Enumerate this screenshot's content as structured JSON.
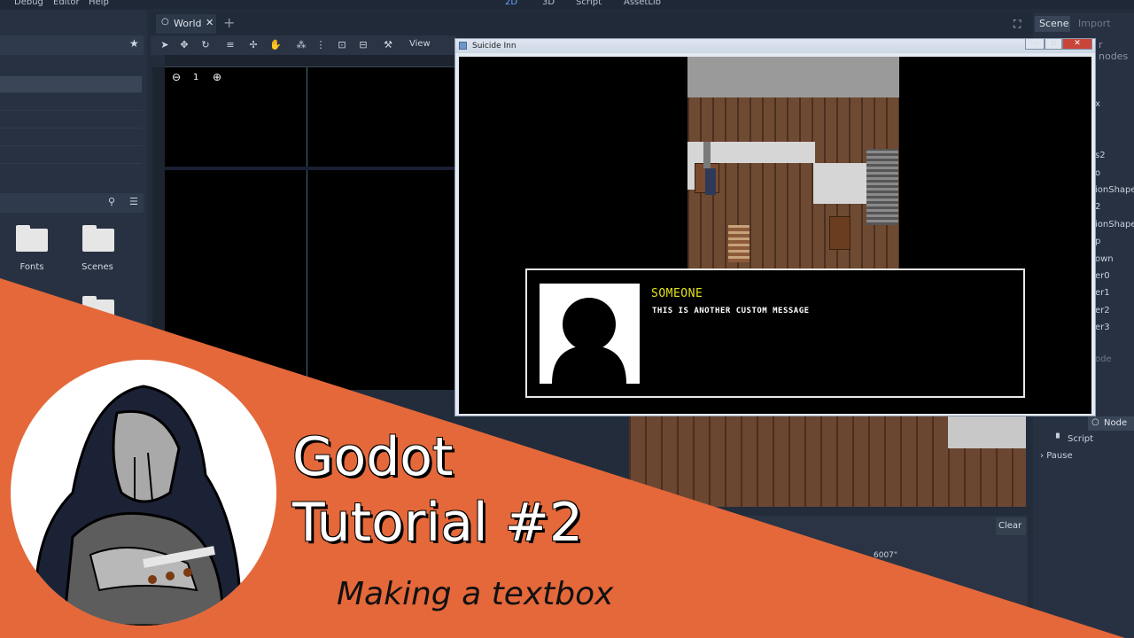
{
  "menu": {
    "debug": "Debug",
    "editor": "Editor",
    "help": "Help"
  },
  "main_modes": {
    "m2d": "2D",
    "m3d": "3D",
    "script": "Script",
    "assetlib": "AssetLib"
  },
  "filesystem": {
    "folders": [
      {
        "label": "Fonts"
      },
      {
        "label": "Scenes"
      }
    ]
  },
  "scene_tab": {
    "label": "World"
  },
  "toolbar": {
    "view_label": "View"
  },
  "viewport": {
    "zoom_value": "1"
  },
  "right_dock": {
    "tabs": {
      "scene": "Scene",
      "import": "Import"
    },
    "filter_placeholder": "r nodes",
    "items": [
      "x",
      "s2",
      "o",
      "ionShape",
      "2",
      "ionShape",
      "p",
      "own",
      "er0",
      "er1",
      "er2",
      "er3"
    ],
    "node_header": "ode",
    "inspector_tab": "Node",
    "script_label": "Script",
    "pause_label": "Pause"
  },
  "game_window": {
    "title": "Suicide Inn"
  },
  "dialog": {
    "speaker": "SOMEONE",
    "message": "THIS IS ANOTHER CUSTOM MESSAGE"
  },
  "output": {
    "clear_label": "Clear",
    "partial_text": "6007\""
  },
  "thumbnail": {
    "title_line1": "Godot",
    "title_line2": "Tutorial #2",
    "subtitle": "Making a textbox"
  },
  "colors": {
    "accent_orange": "#e4683a",
    "speaker_yellow": "#e3e31a",
    "editor_bg": "#222c3b"
  }
}
